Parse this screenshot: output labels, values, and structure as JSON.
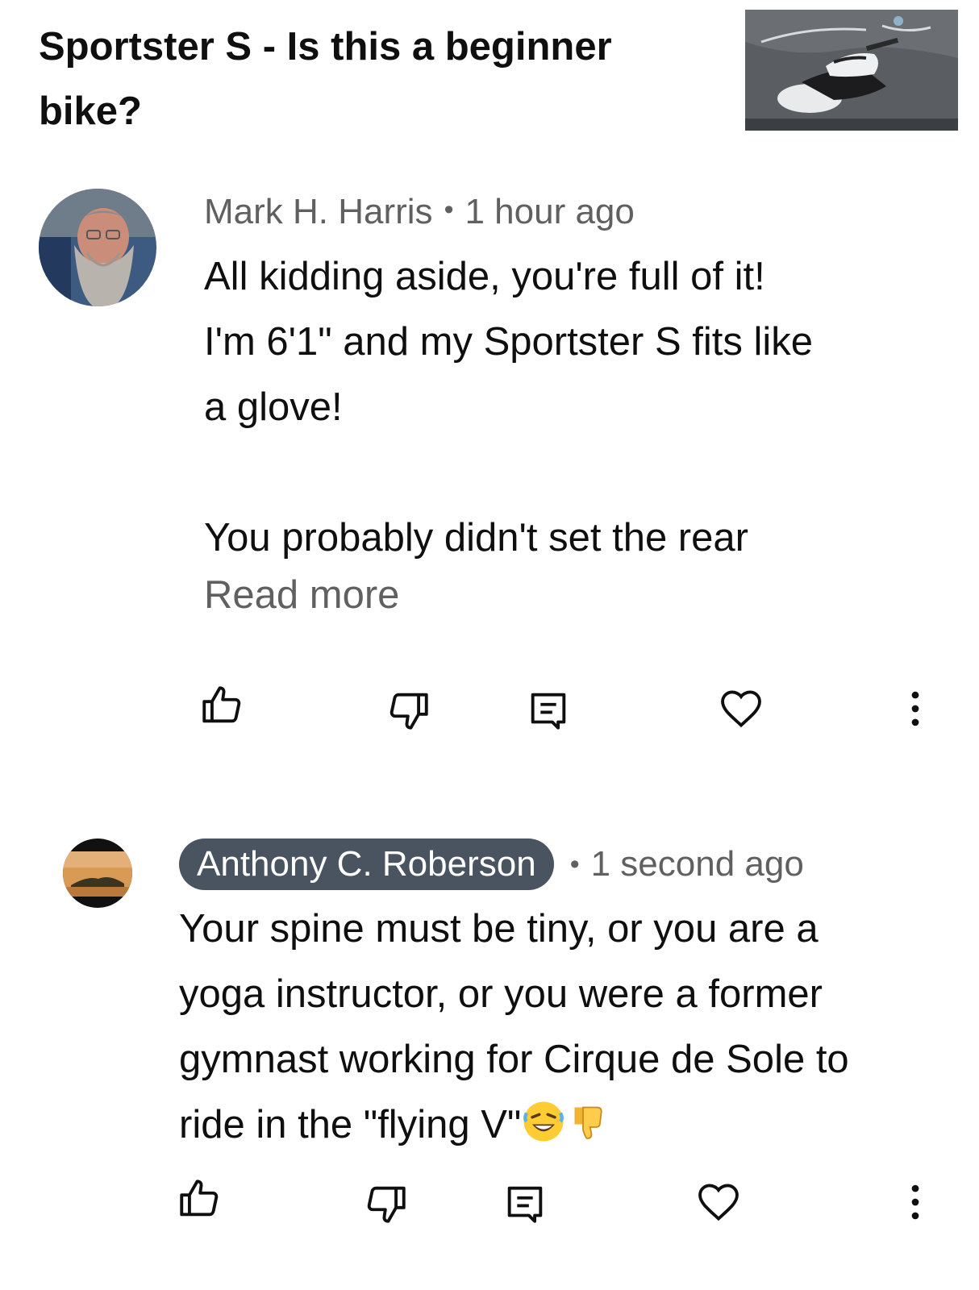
{
  "video": {
    "title": "Sportster S - Is this a beginner bike?"
  },
  "comments": [
    {
      "author": "Mark H. Harris",
      "time": "1 hour ago",
      "text": "All kidding aside, you're full of it!\nI'm 6'1\" and my Sportster S fits like\na glove!\n\nYou probably didn't set the rear",
      "read_more": "Read more"
    },
    {
      "author": "Anthony C. Roberson",
      "time": "1 second ago",
      "text": "Your spine must be tiny, or you are a yoga instructor, or you were a former gymnast working for Cirque de Sole to ride in the \"flying V\"",
      "emojis": [
        "rolling-on-floor-laughing-emoji",
        "thumbs-down-emoji"
      ]
    }
  ],
  "actions": [
    "like-icon",
    "dislike-icon",
    "reply-icon",
    "heart-icon",
    "more-options-icon"
  ],
  "colors": {
    "text_primary": "#0f0f0f",
    "text_secondary": "#606060",
    "author_chip_bg": "#4a5461"
  }
}
